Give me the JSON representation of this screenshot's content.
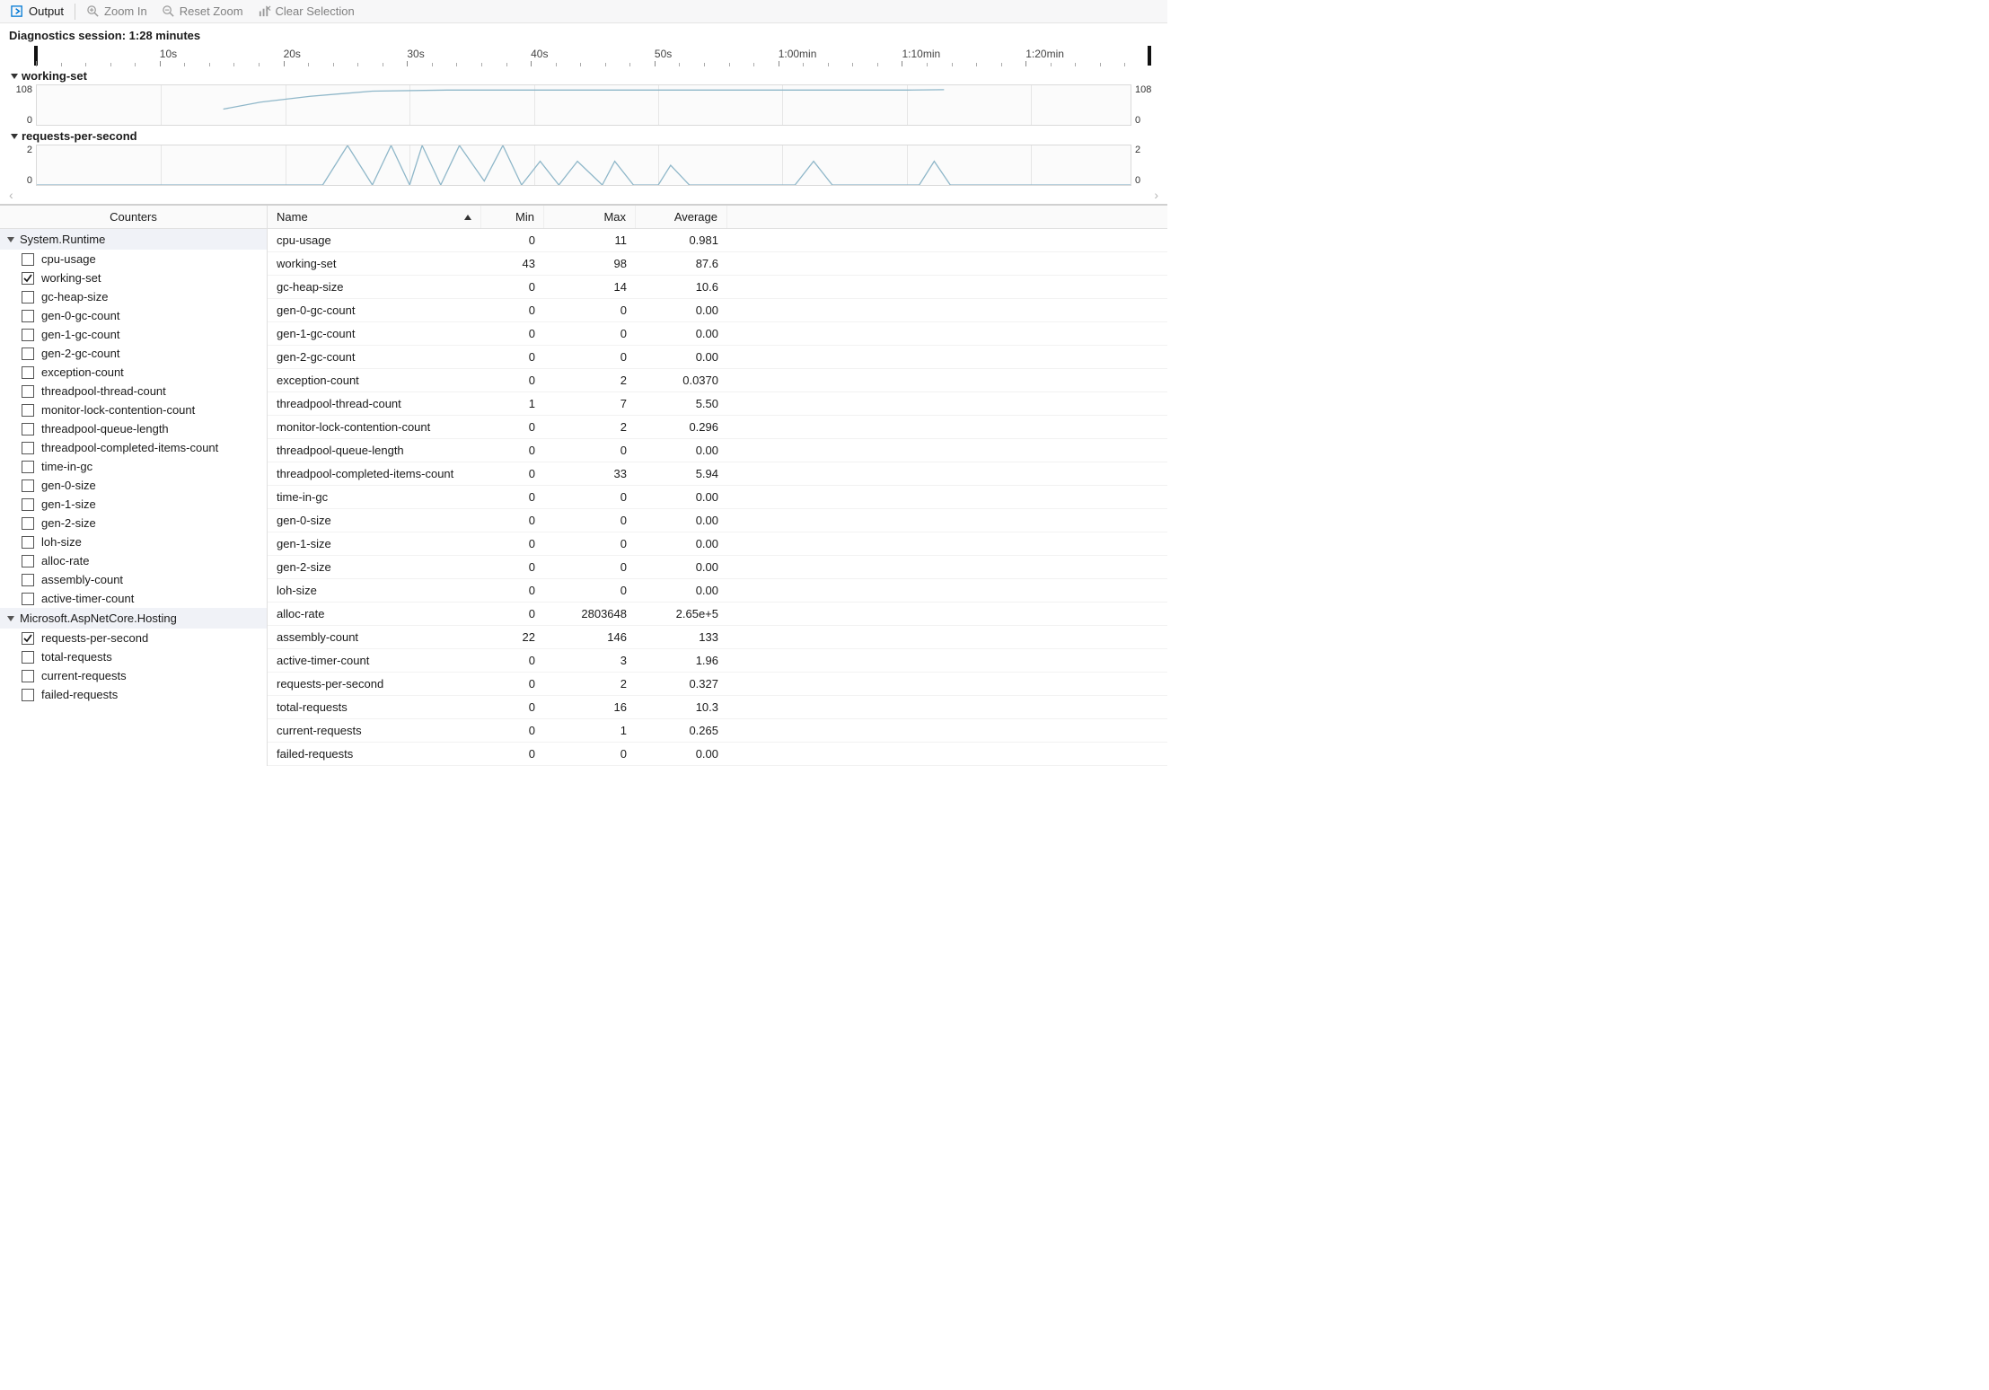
{
  "toolbar": {
    "output": "Output",
    "zoom_in": "Zoom In",
    "reset_zoom": "Reset Zoom",
    "clear_selection": "Clear Selection"
  },
  "session": {
    "label": "Diagnostics session:",
    "value": "1:28 minutes"
  },
  "ruler_ticks": [
    "10s",
    "20s",
    "30s",
    "40s",
    "50s",
    "1:00min",
    "1:10min",
    "1:20min"
  ],
  "chart_data": [
    {
      "type": "line",
      "title": "working-set",
      "ylabel": "",
      "xlabel": "",
      "ylim": [
        0,
        108
      ],
      "y_ticks": [
        "108",
        "0"
      ],
      "series": [
        {
          "name": "working-set",
          "points": [
            [
              15,
              43
            ],
            [
              18,
              62
            ],
            [
              22,
              78
            ],
            [
              27,
              92
            ],
            [
              33,
              95
            ],
            [
              40,
              95
            ],
            [
              48,
              95
            ],
            [
              55,
              95
            ],
            [
              62,
              95
            ],
            [
              70,
              95
            ],
            [
              73,
              96
            ]
          ]
        }
      ]
    },
    {
      "type": "line",
      "title": "requests-per-second",
      "ylabel": "",
      "xlabel": "",
      "ylim": [
        0,
        2
      ],
      "y_ticks": [
        "2",
        "0"
      ],
      "series": [
        {
          "name": "requests-per-second",
          "points": [
            [
              0,
              0
            ],
            [
              23,
              0
            ],
            [
              25,
              2
            ],
            [
              27,
              0
            ],
            [
              28.5,
              2
            ],
            [
              30,
              0
            ],
            [
              31,
              2
            ],
            [
              32.5,
              0
            ],
            [
              34,
              2
            ],
            [
              36,
              0.2
            ],
            [
              37.5,
              2
            ],
            [
              39,
              0
            ],
            [
              40.5,
              1.2
            ],
            [
              42,
              0
            ],
            [
              43.5,
              1.2
            ],
            [
              45.5,
              0
            ],
            [
              46.5,
              1.2
            ],
            [
              48,
              0
            ],
            [
              50,
              0
            ],
            [
              51,
              1
            ],
            [
              52.5,
              0
            ],
            [
              61,
              0
            ],
            [
              62.5,
              1.2
            ],
            [
              64,
              0
            ],
            [
              71,
              0
            ],
            [
              72.2,
              1.2
            ],
            [
              73.5,
              0
            ],
            [
              88,
              0
            ]
          ]
        }
      ]
    }
  ],
  "tree": {
    "header": "Counters",
    "groups": [
      {
        "name": "System.Runtime",
        "items": [
          {
            "label": "cpu-usage",
            "checked": false
          },
          {
            "label": "working-set",
            "checked": true
          },
          {
            "label": "gc-heap-size",
            "checked": false
          },
          {
            "label": "gen-0-gc-count",
            "checked": false
          },
          {
            "label": "gen-1-gc-count",
            "checked": false
          },
          {
            "label": "gen-2-gc-count",
            "checked": false
          },
          {
            "label": "exception-count",
            "checked": false
          },
          {
            "label": "threadpool-thread-count",
            "checked": false
          },
          {
            "label": "monitor-lock-contention-count",
            "checked": false
          },
          {
            "label": "threadpool-queue-length",
            "checked": false
          },
          {
            "label": "threadpool-completed-items-count",
            "checked": false
          },
          {
            "label": "time-in-gc",
            "checked": false
          },
          {
            "label": "gen-0-size",
            "checked": false
          },
          {
            "label": "gen-1-size",
            "checked": false
          },
          {
            "label": "gen-2-size",
            "checked": false
          },
          {
            "label": "loh-size",
            "checked": false
          },
          {
            "label": "alloc-rate",
            "checked": false
          },
          {
            "label": "assembly-count",
            "checked": false
          },
          {
            "label": "active-timer-count",
            "checked": false
          }
        ]
      },
      {
        "name": "Microsoft.AspNetCore.Hosting",
        "items": [
          {
            "label": "requests-per-second",
            "checked": true
          },
          {
            "label": "total-requests",
            "checked": false
          },
          {
            "label": "current-requests",
            "checked": false
          },
          {
            "label": "failed-requests",
            "checked": false
          }
        ]
      }
    ]
  },
  "table": {
    "header": {
      "name": "Name",
      "min": "Min",
      "max": "Max",
      "avg": "Average"
    },
    "rows": [
      {
        "name": "cpu-usage",
        "min": "0",
        "max": "11",
        "avg": "0.981"
      },
      {
        "name": "working-set",
        "min": "43",
        "max": "98",
        "avg": "87.6"
      },
      {
        "name": "gc-heap-size",
        "min": "0",
        "max": "14",
        "avg": "10.6"
      },
      {
        "name": "gen-0-gc-count",
        "min": "0",
        "max": "0",
        "avg": "0.00"
      },
      {
        "name": "gen-1-gc-count",
        "min": "0",
        "max": "0",
        "avg": "0.00"
      },
      {
        "name": "gen-2-gc-count",
        "min": "0",
        "max": "0",
        "avg": "0.00"
      },
      {
        "name": "exception-count",
        "min": "0",
        "max": "2",
        "avg": "0.0370"
      },
      {
        "name": "threadpool-thread-count",
        "min": "1",
        "max": "7",
        "avg": "5.50"
      },
      {
        "name": "monitor-lock-contention-count",
        "min": "0",
        "max": "2",
        "avg": "0.296"
      },
      {
        "name": "threadpool-queue-length",
        "min": "0",
        "max": "0",
        "avg": "0.00"
      },
      {
        "name": "threadpool-completed-items-count",
        "min": "0",
        "max": "33",
        "avg": "5.94"
      },
      {
        "name": "time-in-gc",
        "min": "0",
        "max": "0",
        "avg": "0.00"
      },
      {
        "name": "gen-0-size",
        "min": "0",
        "max": "0",
        "avg": "0.00"
      },
      {
        "name": "gen-1-size",
        "min": "0",
        "max": "0",
        "avg": "0.00"
      },
      {
        "name": "gen-2-size",
        "min": "0",
        "max": "0",
        "avg": "0.00"
      },
      {
        "name": "loh-size",
        "min": "0",
        "max": "0",
        "avg": "0.00"
      },
      {
        "name": "alloc-rate",
        "min": "0",
        "max": "2803648",
        "avg": "2.65e+5"
      },
      {
        "name": "assembly-count",
        "min": "22",
        "max": "146",
        "avg": "133"
      },
      {
        "name": "active-timer-count",
        "min": "0",
        "max": "3",
        "avg": "1.96"
      },
      {
        "name": "requests-per-second",
        "min": "0",
        "max": "2",
        "avg": "0.327"
      },
      {
        "name": "total-requests",
        "min": "0",
        "max": "16",
        "avg": "10.3"
      },
      {
        "name": "current-requests",
        "min": "0",
        "max": "1",
        "avg": "0.265"
      },
      {
        "name": "failed-requests",
        "min": "0",
        "max": "0",
        "avg": "0.00"
      }
    ]
  }
}
